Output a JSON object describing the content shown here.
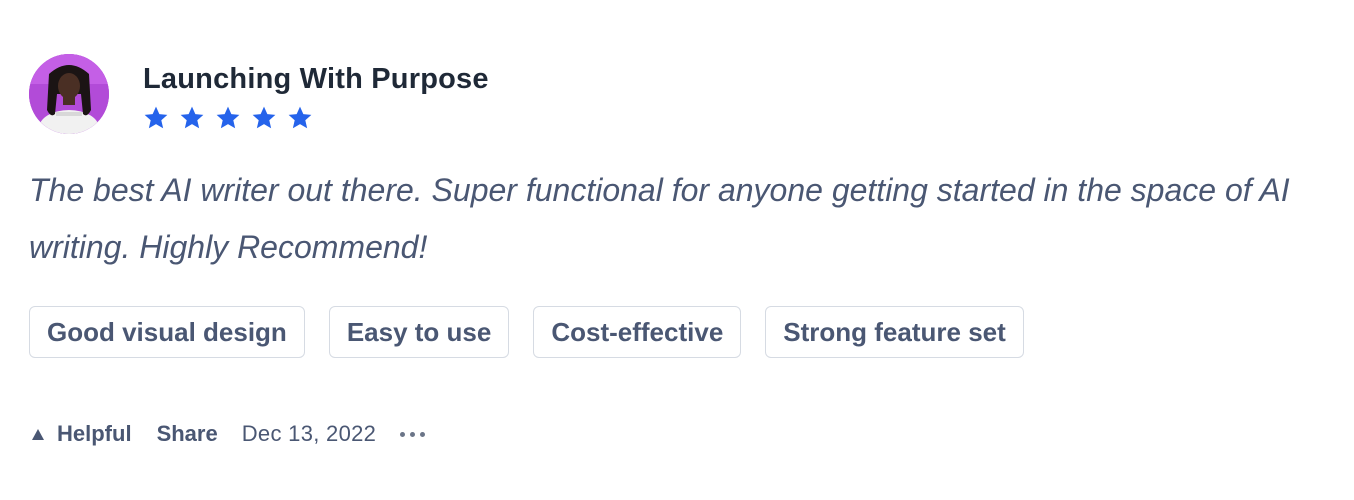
{
  "review": {
    "author": "Launching With Purpose",
    "rating": 5,
    "rating_max": 5,
    "text": "The best AI writer out there. Super functional for anyone getting started in the space of AI writing. Highly Recommend!",
    "tags": [
      "Good visual design",
      "Easy to use",
      "Cost-effective",
      "Strong feature set"
    ],
    "footer": {
      "helpful_label": "Helpful",
      "share_label": "Share",
      "date": "Dec 13, 2022"
    }
  },
  "colors": {
    "star": "#2563eb",
    "text": "#4a5773",
    "title": "#1f2937",
    "tag_border": "#d6dbe3"
  },
  "icons": {
    "helpful": "triangle-up-icon",
    "more": "more-horizontal-icon"
  }
}
